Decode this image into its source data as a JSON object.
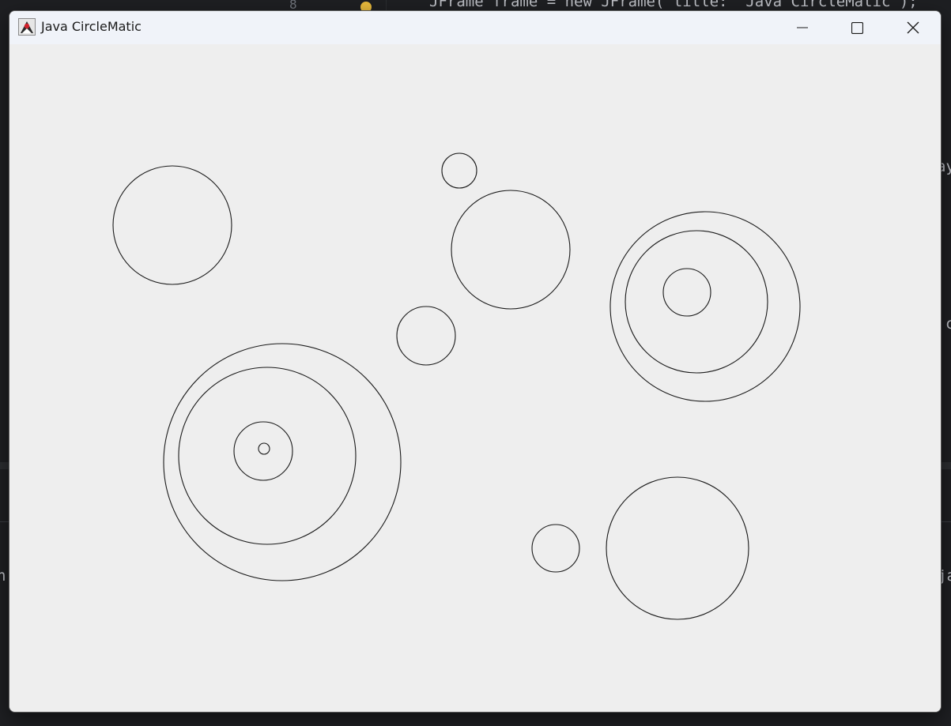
{
  "window": {
    "title": "Java CircleMatic",
    "icon": "java-duke-icon",
    "controls": {
      "minimize_icon": "minimize-icon",
      "maximize_icon": "maximize-icon",
      "close_icon": "close-icon"
    }
  },
  "background_ide": {
    "line_number": "8",
    "code_line": "JFrame frame = new JFrame( title: \"Java CircleMatic\");",
    "right_fragments": [
      "ay",
      "c",
      "ja"
    ],
    "left_fragment": "n"
  },
  "colors": {
    "canvas_bg": "#eeeeee",
    "stroke": "#1a1a1a",
    "titlebar_bg": "#f0f3f9"
  }
}
